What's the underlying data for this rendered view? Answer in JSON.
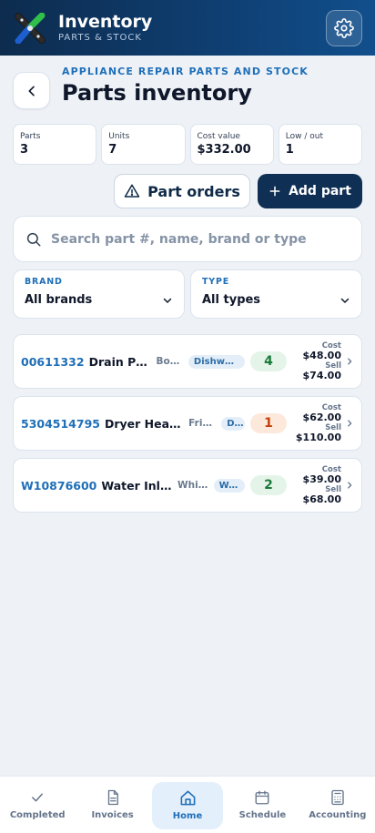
{
  "header": {
    "title": "Inventory",
    "subtitle": "PARTS & STOCK"
  },
  "page": {
    "eyebrow": "APPLIANCE REPAIR PARTS AND STOCK",
    "title": "Parts inventory"
  },
  "stats": [
    {
      "label": "Parts",
      "value": "3"
    },
    {
      "label": "Units",
      "value": "7"
    },
    {
      "label": "Cost value",
      "value": "$332.00"
    },
    {
      "label": "Low / out",
      "value": "1"
    }
  ],
  "actions": {
    "orders_label": "Part orders",
    "add_label": "Add part"
  },
  "search": {
    "placeholder": "Search part #, name, brand or type"
  },
  "filters": {
    "brand": {
      "label": "BRAND",
      "value": "All brands"
    },
    "type": {
      "label": "TYPE",
      "value": "All types"
    }
  },
  "price_labels": {
    "cost": "Cost",
    "sell": "Sell"
  },
  "parts": [
    {
      "number": "00611332",
      "name": "Drain Pu...",
      "brand": "Bos...",
      "type": "Dishwash...",
      "qty": "4",
      "status": "ok",
      "cost": "$48.00",
      "sell": "$74.00"
    },
    {
      "number": "5304514795",
      "name": "Dryer Heatin...",
      "brand": "Frigi...",
      "type": "D...",
      "qty": "1",
      "status": "low",
      "cost": "$62.00",
      "sell": "$110.00"
    },
    {
      "number": "W10876600",
      "name": "Water Inlet...",
      "brand": "Whirl...",
      "type": "Wa...",
      "qty": "2",
      "status": "ok",
      "cost": "$39.00",
      "sell": "$68.00"
    }
  ],
  "nav": [
    {
      "label": "Completed",
      "icon": "check-icon"
    },
    {
      "label": "Invoices",
      "icon": "document-icon"
    },
    {
      "label": "Home",
      "icon": "home-icon"
    },
    {
      "label": "Schedule",
      "icon": "calendar-icon"
    },
    {
      "label": "Accounting",
      "icon": "calculator-icon"
    }
  ],
  "colors": {
    "header": "#0f3f73",
    "accent": "#1f6fb8",
    "primary_button": "#0f2f55",
    "qty_ok": "#1c7a3a",
    "qty_low": "#c2410c"
  }
}
